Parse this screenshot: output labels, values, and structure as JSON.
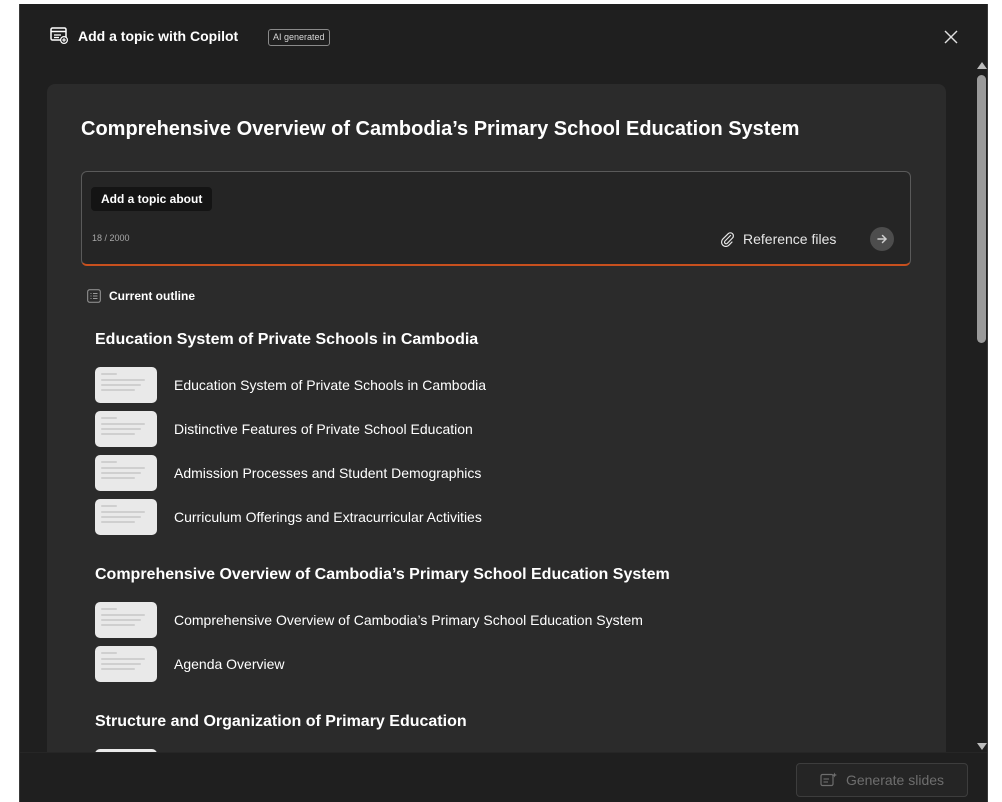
{
  "header": {
    "title": "Add a topic with Copilot",
    "badge": "AI generated"
  },
  "card": {
    "title": "Comprehensive Overview of Cambodia’s Primary School Education System"
  },
  "prompt": {
    "chip": "Add a topic about",
    "char_count": "18 / 2000",
    "reference_files": "Reference files"
  },
  "outline": {
    "label": "Current outline",
    "sections": [
      {
        "heading": "Education System of Private Schools in Cambodia",
        "slides": [
          "Education System of Private Schools in Cambodia",
          "Distinctive Features of Private School Education",
          "Admission Processes and Student Demographics",
          "Curriculum Offerings and Extracurricular Activities"
        ]
      },
      {
        "heading": "Comprehensive Overview of Cambodia’s Primary School Education System",
        "slides": [
          "Comprehensive Overview of Cambodia’s Primary School Education System",
          "Agenda Overview"
        ]
      },
      {
        "heading": "Structure and Organization of Primary Education",
        "slides": [
          ""
        ]
      }
    ]
  },
  "footer": {
    "generate_label": "Generate slides"
  },
  "icons": {
    "header": "add-topic-icon",
    "close": "close-icon",
    "attach": "paperclip-icon",
    "send": "arrow-right-icon",
    "outline": "list-icon",
    "generate": "slides-sparkle-icon"
  }
}
